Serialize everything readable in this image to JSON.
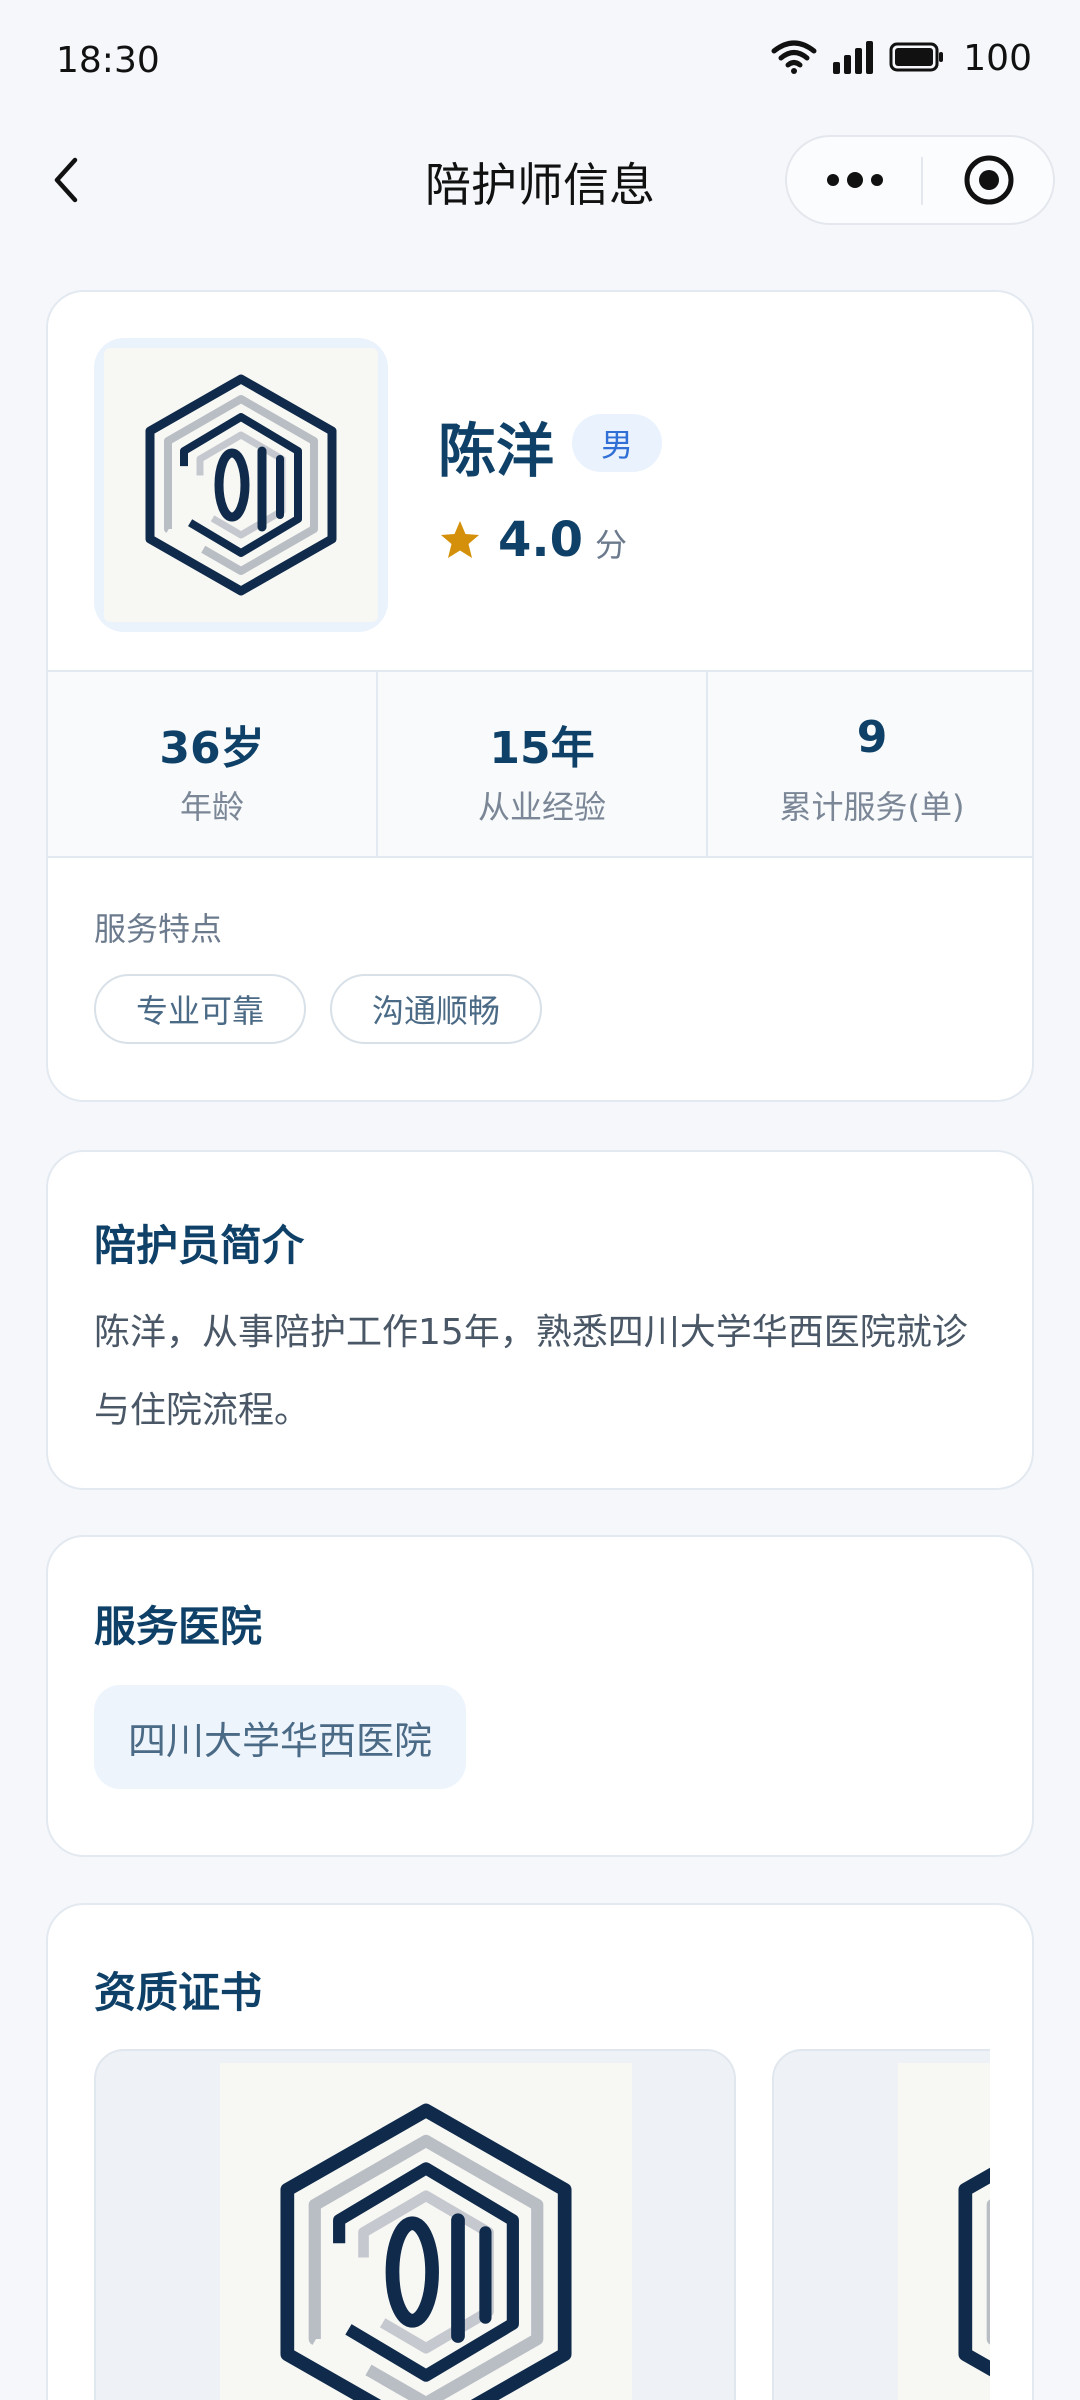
{
  "status_bar": {
    "time": "18:30",
    "battery": "100"
  },
  "nav": {
    "title": "陪护师信息"
  },
  "profile": {
    "name": "陈洋",
    "gender": "男",
    "rating": "4.0",
    "rating_unit": "分",
    "avatar_icon": "hexagon-logo-icon",
    "stats": [
      {
        "value": "36岁",
        "label": "年龄"
      },
      {
        "value": "15年",
        "label": "从业经验"
      },
      {
        "value": "9",
        "label": "累计服务(单)"
      }
    ],
    "features_title": "服务特点",
    "features": [
      "专业可靠",
      "沟通顺畅"
    ]
  },
  "intro": {
    "title": "陪护员简介",
    "text": "陈洋，从事陪护工作15年，熟悉四川大学华西医院就诊与住院流程。"
  },
  "hospital": {
    "title": "服务医院",
    "name": "四川大学华西医院"
  },
  "certificates": {
    "title": "资质证书",
    "items": 2
  },
  "colors": {
    "primary_text": "#0f4168",
    "star": "#d4900a",
    "badge_bg": "#e9f2fd",
    "badge_text": "#2f6fd6",
    "page_bg": "#f5f7fa"
  }
}
